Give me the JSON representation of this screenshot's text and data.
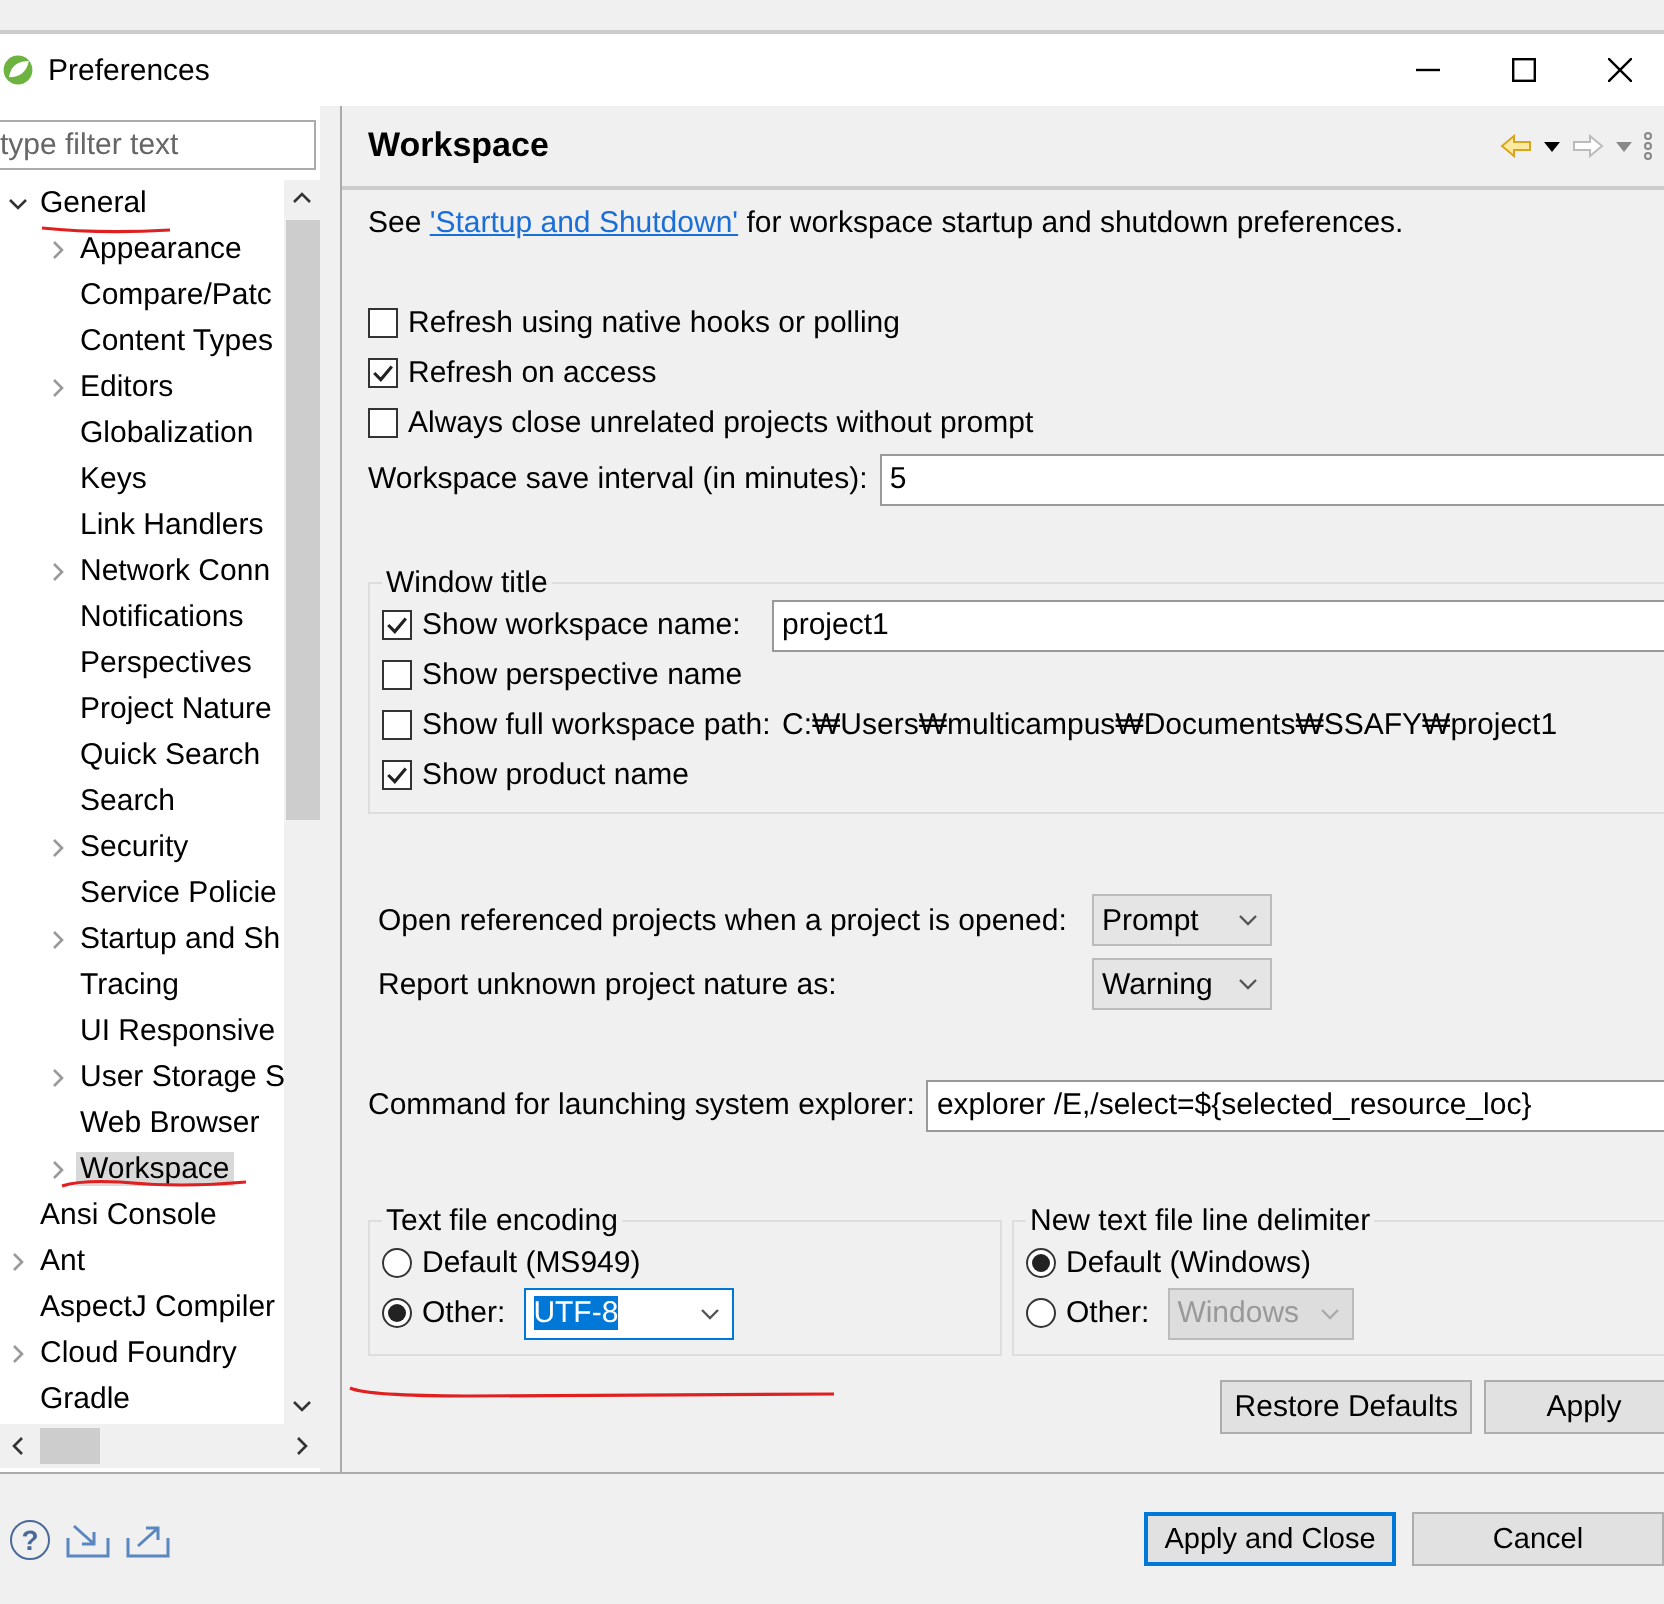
{
  "window": {
    "title": "Preferences"
  },
  "filter": {
    "placeholder": "type filter text"
  },
  "tree": [
    {
      "label": "General",
      "kind": "group",
      "expanded": true,
      "selected": false,
      "children": [
        {
          "label": "Appearance",
          "kind": "group",
          "expanded": false,
          "selected": false
        },
        {
          "label": "Compare/Patc",
          "kind": "page",
          "selected": false
        },
        {
          "label": "Content Types",
          "kind": "page",
          "selected": false
        },
        {
          "label": "Editors",
          "kind": "group",
          "expanded": false,
          "selected": false
        },
        {
          "label": "Globalization",
          "kind": "page",
          "selected": false
        },
        {
          "label": "Keys",
          "kind": "page",
          "selected": false
        },
        {
          "label": "Link Handlers",
          "kind": "page",
          "selected": false
        },
        {
          "label": "Network Conn",
          "kind": "group",
          "expanded": false,
          "selected": false
        },
        {
          "label": "Notifications",
          "kind": "page",
          "selected": false
        },
        {
          "label": "Perspectives",
          "kind": "page",
          "selected": false
        },
        {
          "label": "Project Nature",
          "kind": "page",
          "selected": false
        },
        {
          "label": "Quick Search",
          "kind": "page",
          "selected": false
        },
        {
          "label": "Search",
          "kind": "page",
          "selected": false
        },
        {
          "label": "Security",
          "kind": "group",
          "expanded": false,
          "selected": false
        },
        {
          "label": "Service Policie",
          "kind": "page",
          "selected": false
        },
        {
          "label": "Startup and Sh",
          "kind": "group",
          "expanded": false,
          "selected": false
        },
        {
          "label": "Tracing",
          "kind": "page",
          "selected": false
        },
        {
          "label": "UI Responsive",
          "kind": "page",
          "selected": false
        },
        {
          "label": "User Storage S",
          "kind": "group",
          "expanded": false,
          "selected": false
        },
        {
          "label": "Web Browser",
          "kind": "page",
          "selected": false
        },
        {
          "label": "Workspace",
          "kind": "group",
          "expanded": false,
          "selected": true
        }
      ]
    },
    {
      "label": "Ansi Console",
      "kind": "page",
      "selected": false
    },
    {
      "label": "Ant",
      "kind": "group",
      "expanded": false,
      "selected": false
    },
    {
      "label": "AspectJ Compiler",
      "kind": "page",
      "selected": false
    },
    {
      "label": "Cloud Foundry",
      "kind": "group",
      "expanded": false,
      "selected": false
    },
    {
      "label": "Gradle",
      "kind": "page",
      "selected": false
    }
  ],
  "page": {
    "title": "Workspace",
    "intro": {
      "before": "See ",
      "link": "'Startup and Shutdown'",
      "after": " for workspace startup and shutdown preferences."
    },
    "checkboxes": [
      {
        "label": "Refresh using native hooks or polling",
        "checked": false
      },
      {
        "label": "Refresh on access",
        "checked": true
      },
      {
        "label": "Always close unrelated projects without prompt",
        "checked": false
      }
    ],
    "save_interval": {
      "label": "Workspace save interval (in minutes):",
      "value": "5"
    },
    "window_title": {
      "legend": "Window title",
      "workspace_name": {
        "label": "Show workspace name:",
        "checked": true,
        "value": "project1"
      },
      "perspective_name": {
        "label": "Show perspective name",
        "checked": false
      },
      "full_path": {
        "label": "Show full workspace path:",
        "checked": false,
        "path": "C:₩Users₩multicampus₩Documents₩SSAFY₩project1"
      },
      "product_name": {
        "label": "Show product name",
        "checked": true
      }
    },
    "selects": [
      {
        "label": "Open referenced projects when a project is opened:",
        "value": "Prompt"
      },
      {
        "label": "Report unknown project nature as:",
        "value": "Warning"
      }
    ],
    "explorer": {
      "label": "Command for launching system explorer:",
      "value": "explorer /E,/select=${selected_resource_loc}"
    },
    "encoding": {
      "legend": "Text file encoding",
      "options": [
        {
          "label": "Default (MS949)",
          "selected": false
        },
        {
          "label": "Other:",
          "selected": true
        }
      ],
      "value": "UTF-8",
      "disabled": false
    },
    "delimiter": {
      "legend": "New text file line delimiter",
      "options": [
        {
          "label": "Default (Windows)",
          "selected": true
        },
        {
          "label": "Other:",
          "selected": false
        }
      ],
      "value": "Windows",
      "disabled": true
    },
    "buttons": [
      "Restore Defaults",
      "Apply"
    ]
  },
  "help": {
    "glyph": "?"
  },
  "footer_buttons": [
    {
      "label": "Apply and Close",
      "default": true
    },
    {
      "label": "Cancel",
      "default": false
    }
  ]
}
